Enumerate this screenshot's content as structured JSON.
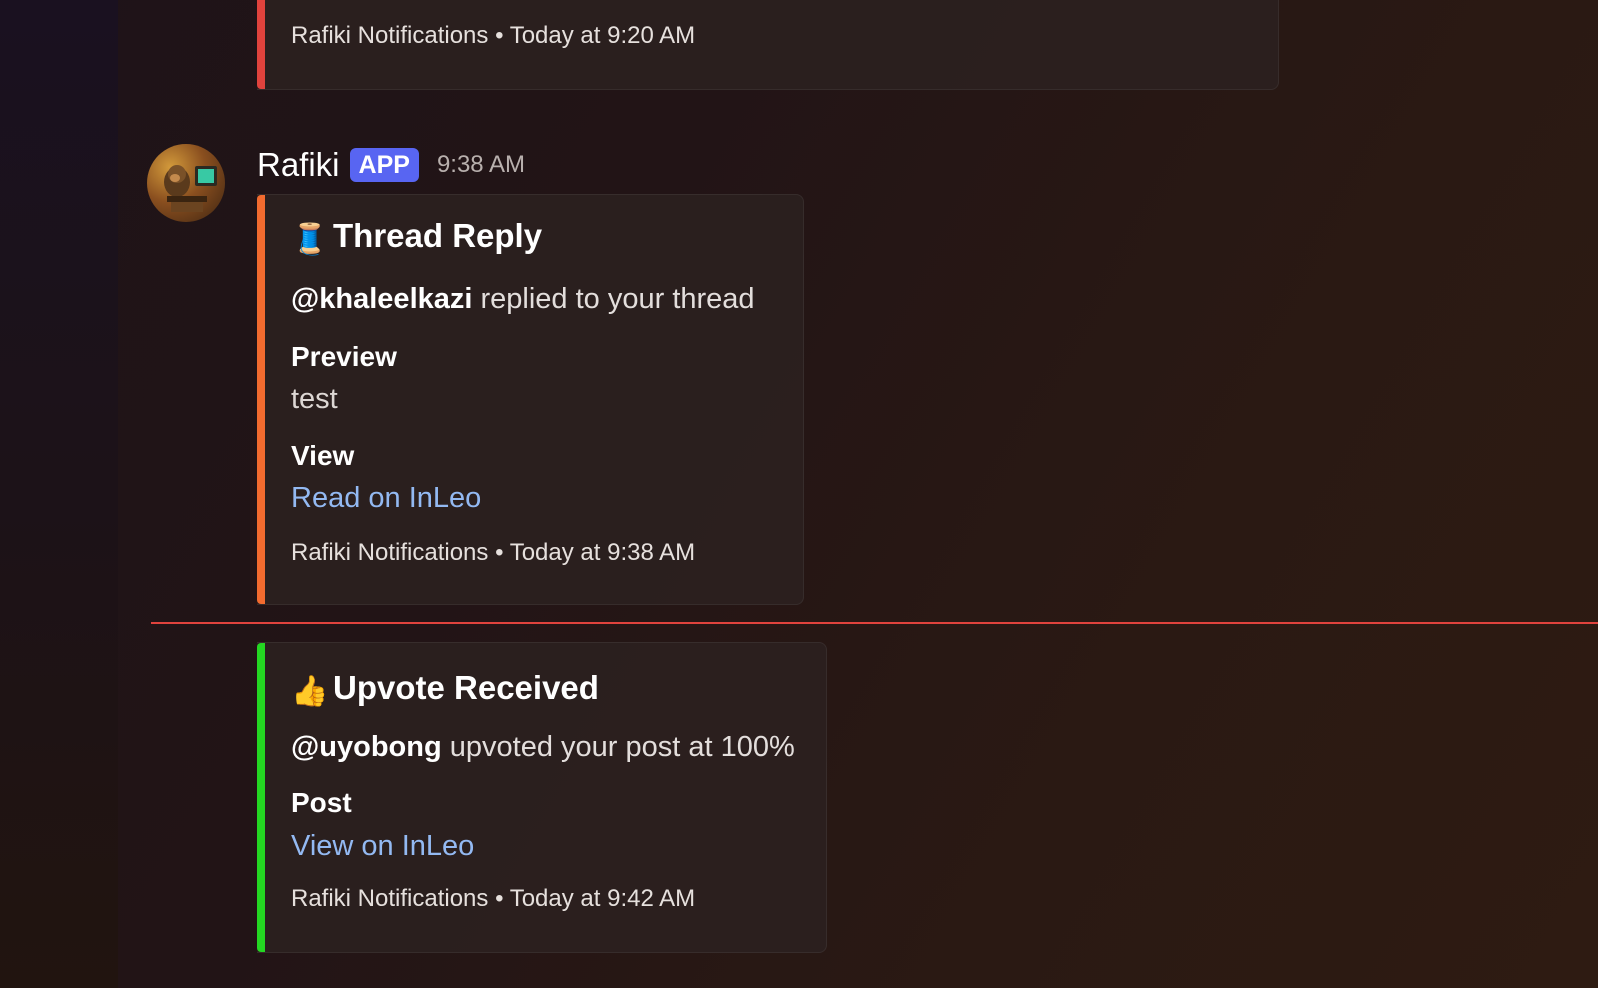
{
  "colors": {
    "accent_red": "#e0433d",
    "accent_orange": "#f26b2f",
    "accent_green": "#24d722",
    "app_badge": "#5865f2",
    "link": "#93b9f2"
  },
  "prev_embed": {
    "footer": "Rafiki Notifications • Today at 9:20 AM"
  },
  "message": {
    "author": "Rafiki",
    "badge": "APP",
    "time": "9:38 AM",
    "avatar_icon": "monkey-at-computer-avatar"
  },
  "thread_embed": {
    "emoji": "🧵",
    "emoji_icon": "spool-of-thread-icon",
    "title": "Thread Reply",
    "mention": "@khaleelkazi",
    "description_rest": " replied to your thread",
    "field1_name": "Preview",
    "field1_value": "test",
    "field2_name": "View",
    "field2_link": "Read on InLeo",
    "footer": "Rafiki Notifications • Today at 9:38 AM"
  },
  "upvote_embed": {
    "emoji": "👍",
    "emoji_icon": "thumbs-up-icon",
    "title": "Upvote Received",
    "mention": "@uyobong",
    "description_rest": " upvoted your post at 100%",
    "field1_name": "Post",
    "field1_link": "View on InLeo",
    "footer": "Rafiki Notifications • Today at 9:42 AM"
  }
}
